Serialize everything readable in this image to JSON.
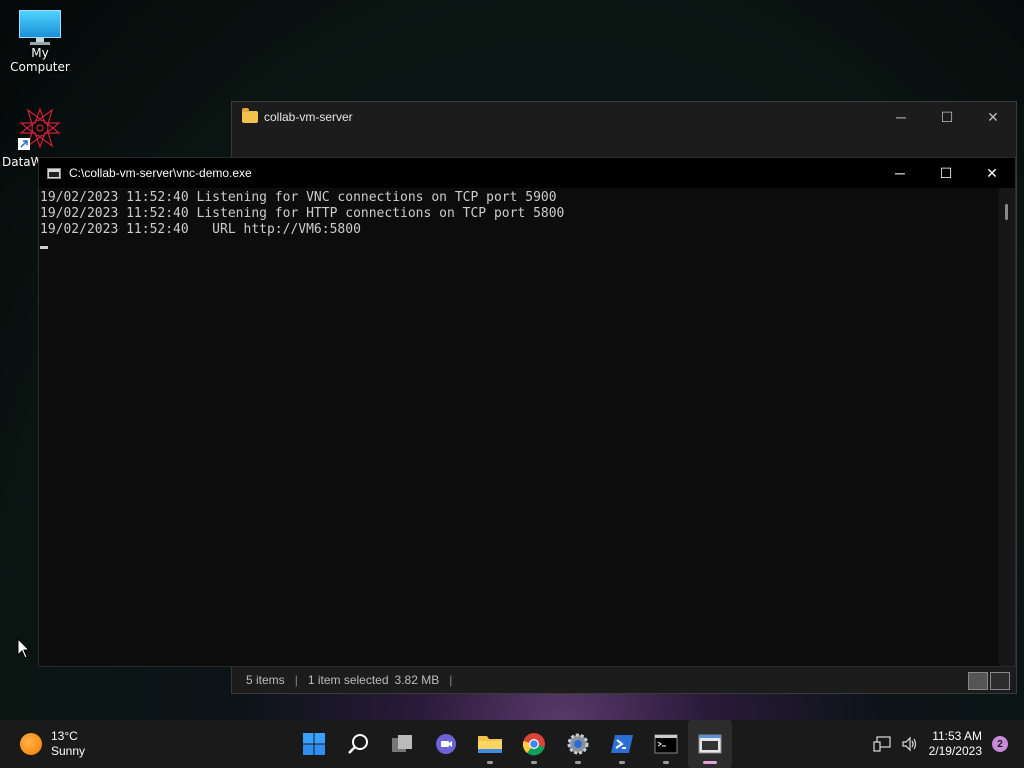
{
  "desktop": {
    "icons": [
      {
        "label": "My Computer"
      },
      {
        "label": "DataW"
      }
    ]
  },
  "explorer": {
    "title": "collab-vm-server",
    "status": {
      "items": "5 items",
      "selected": "1 item selected",
      "size": "3.82 MB"
    }
  },
  "console": {
    "title": "C:\\collab-vm-server\\vnc-demo.exe",
    "lines": [
      "19/02/2023 11:52:40 Listening for VNC connections on TCP port 5900",
      "19/02/2023 11:52:40 Listening for HTTP connections on TCP port 5800",
      "19/02/2023 11:52:40   URL http://VM6:5800"
    ]
  },
  "window_controls": {
    "minimize": "─",
    "maximize": "☐",
    "close": "✕"
  },
  "taskbar": {
    "weather": {
      "temp": "13°C",
      "condition": "Sunny"
    },
    "apps": [
      "start-icon",
      "search-icon",
      "task-view-icon",
      "teams-chat-icon",
      "file-explorer-icon",
      "chrome-icon",
      "settings-icon",
      "powershell-icon",
      "terminal-icon",
      "vnc-demo-icon"
    ],
    "clock": {
      "time": "11:53 AM",
      "date": "2/19/2023"
    },
    "notifications": "2"
  }
}
